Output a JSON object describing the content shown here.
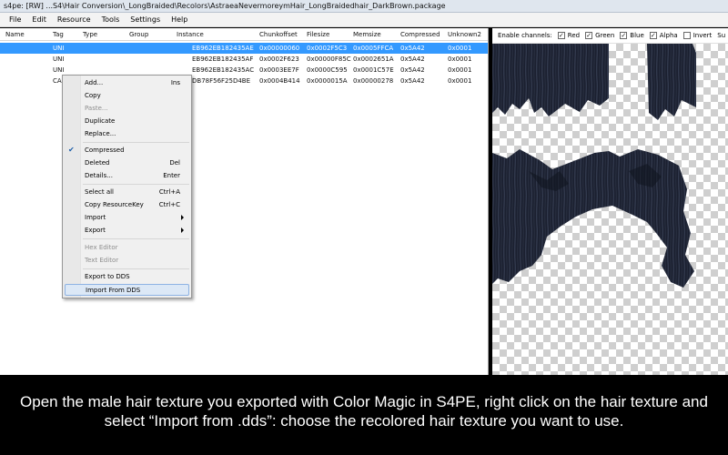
{
  "window": {
    "title": "s4pe: [RW] ...S4\\Hair Conversion\\_LongBraided\\Recolors\\AstraeaNevermoreymHair_LongBraidedhair_DarkBrown.package"
  },
  "menu": [
    "File",
    "Edit",
    "Resource",
    "Tools",
    "Settings",
    "Help"
  ],
  "table": {
    "headers": [
      "Name",
      "Tag",
      "Type",
      "Group",
      "Instance",
      "Chunkoffset",
      "Filesize",
      "Memsize",
      "Compressed",
      "Unknown2"
    ],
    "rows": [
      {
        "tag": "UNI",
        "instance": "EB962EB182435AE",
        "chunk": "0x00000060",
        "filesize": "0x0002F5C3",
        "memsize": "0x0005FFCA",
        "compressed": "0x5A42",
        "unknown2": "0x0001"
      },
      {
        "tag": "UNI",
        "instance": "EB962EB182435AF",
        "chunk": "0x0002F623",
        "filesize": "0x00000F85C",
        "memsize": "0x0002651A",
        "compressed": "0x5A42",
        "unknown2": "0x0001"
      },
      {
        "tag": "UNI",
        "instance": "EB962EB182435AC",
        "chunk": "0x0003EE7F",
        "filesize": "0x0000C595",
        "memsize": "0x0001C57E",
        "compressed": "0x5A42",
        "unknown2": "0x0001"
      },
      {
        "tag": "CAS",
        "instance": "DB78F56F25D4BE",
        "chunk": "0x0004B414",
        "filesize": "0x0000015A",
        "memsize": "0x00000278",
        "compressed": "0x5A42",
        "unknown2": "0x0001"
      }
    ]
  },
  "context_menu": {
    "add": {
      "label": "Add...",
      "shortcut": "Ins"
    },
    "copy": {
      "label": "Copy"
    },
    "paste": {
      "label": "Paste..."
    },
    "duplicate": {
      "label": "Duplicate"
    },
    "replace": {
      "label": "Replace..."
    },
    "compressed": {
      "label": "Compressed",
      "checked": true
    },
    "deleted": {
      "label": "Deleted",
      "shortcut": "Del"
    },
    "details": {
      "label": "Details...",
      "shortcut": "Enter"
    },
    "select_all": {
      "label": "Select all",
      "shortcut": "Ctrl+A"
    },
    "copy_key": {
      "label": "Copy ResourceKey",
      "shortcut": "Ctrl+C"
    },
    "import": {
      "label": "Import"
    },
    "export": {
      "label": "Export"
    },
    "hex_editor": {
      "label": "Hex Editor"
    },
    "text_editor": {
      "label": "Text Editor"
    },
    "export_dds": {
      "label": "Export to DDS"
    },
    "import_dds": {
      "label": "Import From DDS"
    }
  },
  "channels": {
    "label": "Enable channels:",
    "red": "Red",
    "green": "Green",
    "blue": "Blue",
    "alpha": "Alpha",
    "invert": "Invert",
    "more": "Su"
  },
  "caption": "Open the male hair texture you exported with Color Magic in S4PE, right click on the hair texture and select “Import from .dds”: choose the recolored hair texture you want to use.",
  "colors": {
    "selection": "#3399ff",
    "hair": "#1b2030",
    "checker": "#cfcfcf"
  }
}
